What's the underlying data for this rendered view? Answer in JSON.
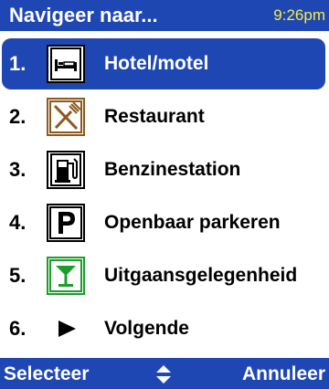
{
  "header": {
    "title": "Navigeer naar...",
    "time": "9:26pm"
  },
  "menu": {
    "selected_index": 0,
    "items": [
      {
        "number": "1.",
        "label": "Hotel/motel",
        "icon": "bed-icon"
      },
      {
        "number": "2.",
        "label": "Restaurant",
        "icon": "fork-knife-icon"
      },
      {
        "number": "3.",
        "label": "Benzinestation",
        "icon": "fuel-pump-icon"
      },
      {
        "number": "4.",
        "label": "Openbaar parkeren",
        "icon": "parking-icon"
      },
      {
        "number": "5.",
        "label": "Uitgaansgelegenheid",
        "icon": "cocktail-icon"
      },
      {
        "number": "6.",
        "label": "Volgende",
        "icon": "play-arrow-icon"
      }
    ]
  },
  "softkeys": {
    "left": "Selecteer",
    "center_icon": "up-down-arrows-icon",
    "right": "Annuleer"
  },
  "colors": {
    "bar_blue": "#1f47b4",
    "clock_yellow": "#f4f040",
    "restaurant_brown": "#8b5a1e",
    "nightlife_green": "#1a9e2a"
  }
}
